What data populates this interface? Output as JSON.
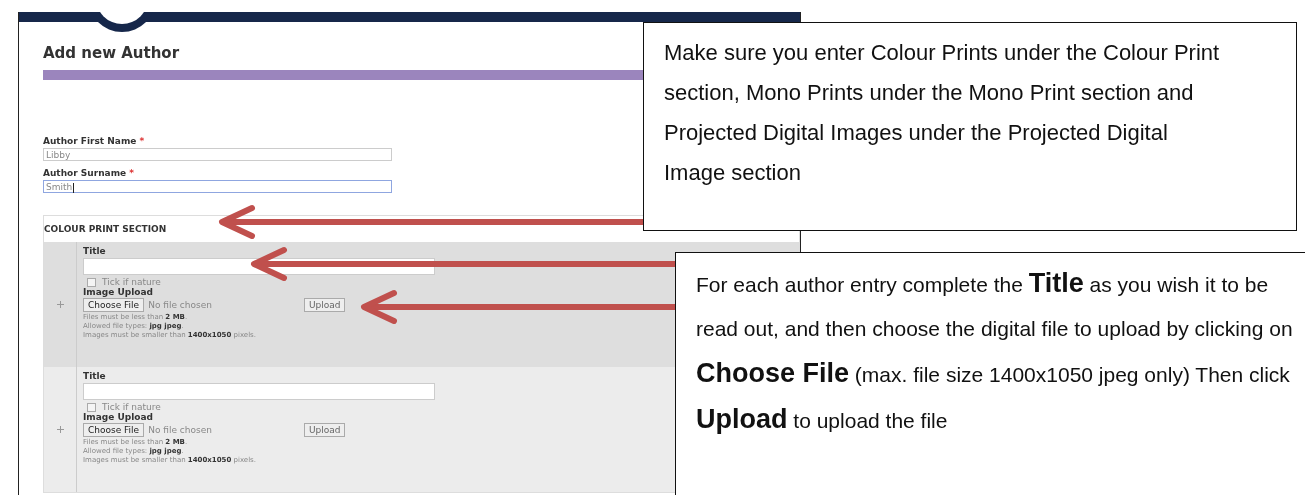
{
  "page": {
    "title": "Add new Author",
    "fields": [
      {
        "label": "Author First Name",
        "required_mark": "*",
        "value": "Libby",
        "focused": false
      },
      {
        "label": "Author Surname",
        "required_mark": "*",
        "value": "Smith",
        "focused": true
      }
    ],
    "section": {
      "heading": "COLOUR PRINT SECTION",
      "entries": [
        {
          "title_label": "Title",
          "tick_label": "Tick if nature",
          "checked": false,
          "upload_label": "Image Upload",
          "choose_button": "Choose File",
          "file_status": "No file chosen",
          "upload_button": "Upload",
          "notes": [
            "Files must be less than **2 MB**.",
            "Allowed file types: **jpg jpeg**.",
            "Images must be smaller than **1400x1050** pixels."
          ],
          "selected": true
        },
        {
          "title_label": "Title",
          "tick_label": "Tick if nature",
          "checked": false,
          "upload_label": "Image Upload",
          "choose_button": "Choose File",
          "file_status": "No file chosen",
          "upload_button": "Upload",
          "notes": [
            "Files must be less than **2 MB**.",
            "Allowed file types: **jpg jpeg**.",
            "Images must be smaller than **1400x1050** pixels."
          ],
          "selected": false
        }
      ]
    }
  },
  "callouts": [
    {
      "text": "Make sure you enter Colour Prints under the Colour Print section, Mono Prints under the Mono Print section and Projected Digital Images under the Projected Digital Image section"
    },
    {
      "text": "For each author entry complete the **Title** as you wish it to be read out, and then choose the digital file to upload by clicking on  **Choose File** (max. file size 1400x1050 jpeg only) Then click **Upload** to upload the file"
    }
  ]
}
